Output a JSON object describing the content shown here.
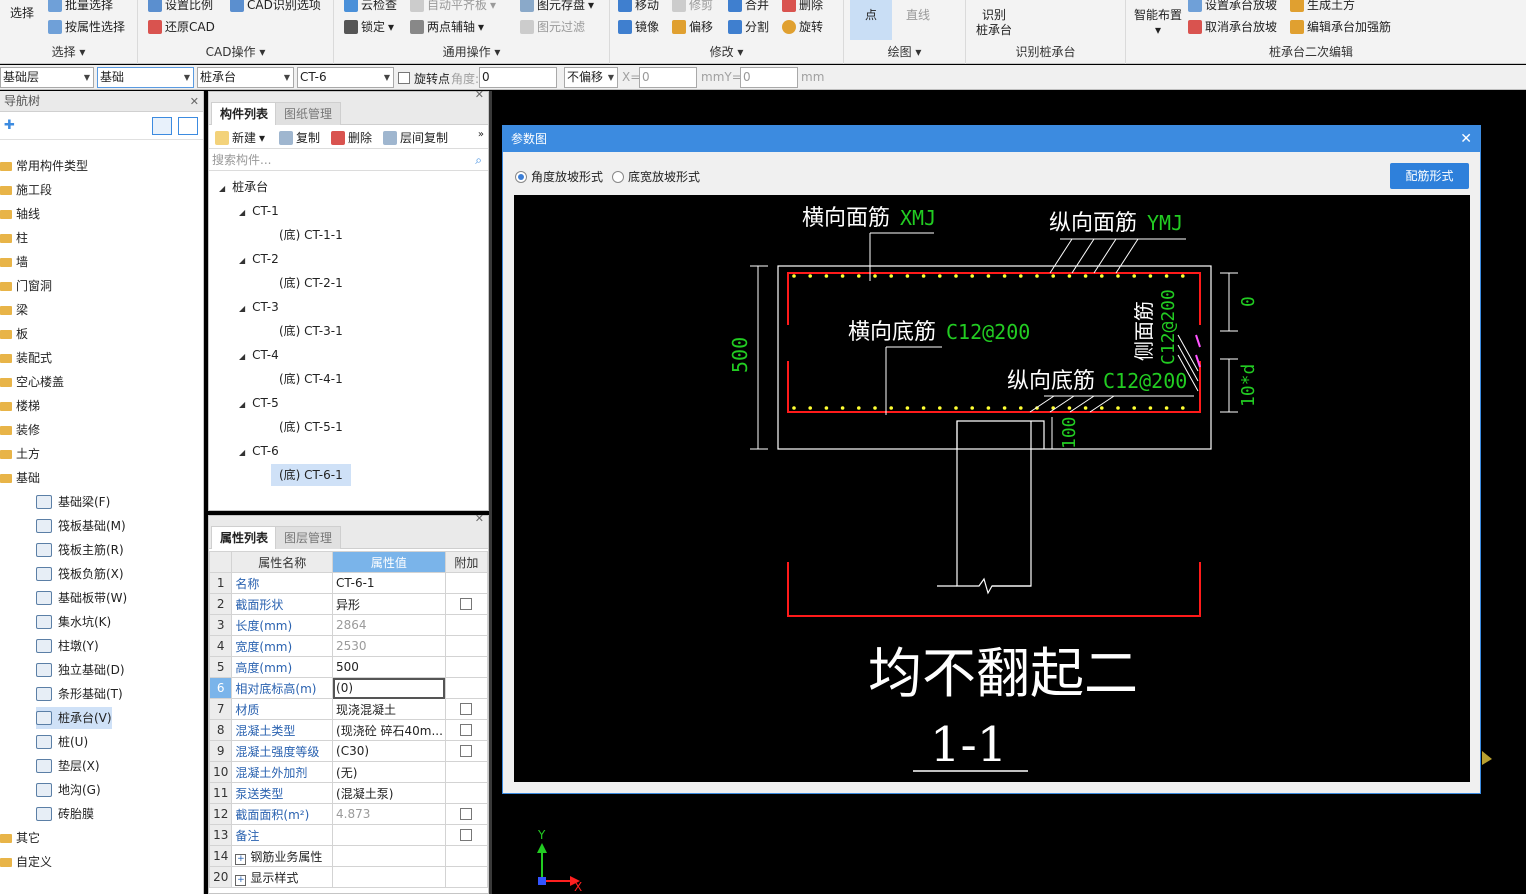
{
  "ribbon": {
    "select": {
      "btn_select": "选择",
      "batch": "批量选择",
      "by_attr": "按属性选择",
      "group": "选择"
    },
    "cad": {
      "set_ratio": "设置比例",
      "cad_options": "CAD识别选项",
      "restore_cad": "还原CAD",
      "group": "CAD操作"
    },
    "common": {
      "cloud_check": "云检查",
      "auto_level": "自动平齐板",
      "element_save": "图元存盘",
      "lock": "锁定",
      "two_point_axis": "两点辅轴",
      "element_filter": "图元过滤",
      "group": "通用操作"
    },
    "modify": {
      "move": "移动",
      "trim": "修剪",
      "merge": "合并",
      "delete": "删除",
      "mirror": "镜像",
      "offset": "偏移",
      "split": "分割",
      "rotate": "旋转",
      "group": "修改"
    },
    "draw": {
      "point": "点",
      "line": "直线",
      "group": "绘图"
    },
    "identify": {
      "identify_pile_cap": "识别\n桩承台",
      "group": "识别桩承台"
    },
    "secondary": {
      "smart_layout": "智能布置",
      "set_slope": "设置承台放坡",
      "cancel_slope": "取消承台放坡",
      "gen_earth": "生成土方",
      "edit_rebar": "编辑承台加强筋",
      "group": "桩承台二次编辑"
    }
  },
  "propbar": {
    "floor": "基础层",
    "category": "基础",
    "type": "桩承台",
    "component": "CT-6",
    "rotate_point": "旋转点",
    "angle_label": "角度:",
    "angle_value": "0",
    "offset_mode": "不偏移",
    "x_label": "X=",
    "x_value": "0",
    "mm1": "mmY=",
    "y_value": "0",
    "mm2": "mm"
  },
  "nav": {
    "title": "导航树",
    "items": [
      "常用构件类型",
      "施工段",
      "轴线",
      "柱",
      "墙",
      "门窗洞",
      "梁",
      "板",
      "装配式",
      "空心楼盖",
      "楼梯",
      "装修",
      "土方",
      "基础"
    ],
    "sub": [
      "基础梁(F)",
      "筏板基础(M)",
      "筏板主筋(R)",
      "筏板负筋(X)",
      "基础板带(W)",
      "集水坑(K)",
      "柱墩(Y)",
      "独立基础(D)",
      "条形基础(T)",
      "桩承台(V)",
      "桩(U)",
      "垫层(X)",
      "地沟(G)",
      "砖胎膜"
    ],
    "tail": [
      "其它",
      "自定义"
    ]
  },
  "comp": {
    "tab1": "构件列表",
    "tab2": "图纸管理",
    "new": "新建",
    "copy": "复制",
    "delete": "删除",
    "floor_copy": "层间复制",
    "search_placeholder": "搜索构件...",
    "root": "桩承台",
    "tree": [
      {
        "name": "CT-1",
        "child": "(底) CT-1-1"
      },
      {
        "name": "CT-2",
        "child": "(底) CT-2-1"
      },
      {
        "name": "CT-3",
        "child": "(底) CT-3-1"
      },
      {
        "name": "CT-4",
        "child": "(底) CT-4-1"
      },
      {
        "name": "CT-5",
        "child": "(底) CT-5-1"
      },
      {
        "name": "CT-6",
        "child": "(底) CT-6-1"
      }
    ]
  },
  "attr": {
    "tab1": "属性列表",
    "tab2": "图层管理",
    "headers": [
      "属性名称",
      "属性值",
      "附加"
    ],
    "rows": [
      {
        "n": "1",
        "k": "名称",
        "v": "CT-6-1"
      },
      {
        "n": "2",
        "k": "截面形状",
        "v": "异形"
      },
      {
        "n": "3",
        "k": "长度(mm)",
        "v": "2864"
      },
      {
        "n": "4",
        "k": "宽度(mm)",
        "v": "2530"
      },
      {
        "n": "5",
        "k": "高度(mm)",
        "v": "500"
      },
      {
        "n": "6",
        "k": "相对底标高(m)",
        "v": "(0)"
      },
      {
        "n": "7",
        "k": "材质",
        "v": "现浇混凝土"
      },
      {
        "n": "8",
        "k": "混凝土类型",
        "v": "(现浇砼 碎石40m..."
      },
      {
        "n": "9",
        "k": "混凝土强度等级",
        "v": "(C30)"
      },
      {
        "n": "10",
        "k": "混凝土外加剂",
        "v": "(无)"
      },
      {
        "n": "11",
        "k": "泵送类型",
        "v": "(混凝土泵)"
      },
      {
        "n": "12",
        "k": "截面面积(m²)",
        "v": "4.873"
      },
      {
        "n": "13",
        "k": "备注",
        "v": ""
      },
      {
        "n": "14",
        "k": "钢筋业务属性",
        "v": ""
      },
      {
        "n": "20",
        "k": "显示样式",
        "v": ""
      }
    ]
  },
  "dialog": {
    "title": "参数图",
    "radio1": "角度放坡形式",
    "radio2": "底宽放坡形式",
    "button": "配筋形式"
  },
  "drawing": {
    "hx_label": "横向面筋",
    "hx_value": "XMJ",
    "zx_label": "纵向面筋",
    "zx_value": "YMJ",
    "hd_label": "横向底筋",
    "hd_value": "C12@200",
    "zd_label": "纵向底筋",
    "zd_value": "C12@200",
    "side_label": "侧面筋",
    "side_value": "C12@200",
    "dim_h": "500",
    "dim_top": "0",
    "dim_10d": "10*d",
    "dim_100": "100",
    "note": "均不翻起二",
    "section": "1-1"
  },
  "axis": {
    "x": "X",
    "y": "Y"
  },
  "colors": {
    "accent": "#3c8be0",
    "red": "#ff1a1a",
    "green": "#22cc22",
    "yellow": "#ffff33"
  }
}
